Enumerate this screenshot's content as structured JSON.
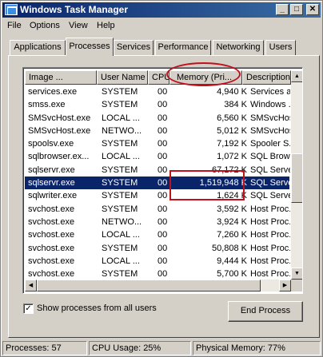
{
  "window": {
    "title": "Windows Task Manager",
    "minimize": "_",
    "maximize": "□",
    "close": "✕"
  },
  "menu": [
    "File",
    "Options",
    "View",
    "Help"
  ],
  "tabs": [
    "Applications",
    "Processes",
    "Services",
    "Performance",
    "Networking",
    "Users"
  ],
  "active_tab": "Processes",
  "columns": [
    "Image ...",
    "User Name",
    "CPU",
    "Memory (Pri...",
    "Description"
  ],
  "sorted_column": "Memory (Pri...",
  "processes": [
    {
      "image": "services.exe",
      "user": "SYSTEM",
      "cpu": "00",
      "memory": "4,940 K",
      "desc": "Services a..."
    },
    {
      "image": "smss.exe",
      "user": "SYSTEM",
      "cpu": "00",
      "memory": "384 K",
      "desc": "Windows ..."
    },
    {
      "image": "SMSvcHost.exe",
      "user": "LOCAL ...",
      "cpu": "00",
      "memory": "6,560 K",
      "desc": "SMSvcHos..."
    },
    {
      "image": "SMSvcHost.exe",
      "user": "NETWO...",
      "cpu": "00",
      "memory": "5,012 K",
      "desc": "SMSvcHos..."
    },
    {
      "image": "spoolsv.exe",
      "user": "SYSTEM",
      "cpu": "00",
      "memory": "7,192 K",
      "desc": "Spooler S..."
    },
    {
      "image": "sqlbrowser.ex...",
      "user": "LOCAL ...",
      "cpu": "00",
      "memory": "1,072 K",
      "desc": "SQL Brow..."
    },
    {
      "image": "sqlservr.exe",
      "user": "SYSTEM",
      "cpu": "00",
      "memory": "67,172 K",
      "desc": "SQL Serve..."
    },
    {
      "image": "sqlservr.exe",
      "user": "SYSTEM",
      "cpu": "00",
      "memory": "1,519,948 K",
      "desc": "SQL Serve..."
    },
    {
      "image": "sqlwriter.exe",
      "user": "SYSTEM",
      "cpu": "00",
      "memory": "1,624 K",
      "desc": "SQL Serve..."
    },
    {
      "image": "svchost.exe",
      "user": "SYSTEM",
      "cpu": "00",
      "memory": "3,592 K",
      "desc": "Host Proc..."
    },
    {
      "image": "svchost.exe",
      "user": "NETWO...",
      "cpu": "00",
      "memory": "3,924 K",
      "desc": "Host Proc..."
    },
    {
      "image": "svchost.exe",
      "user": "LOCAL ...",
      "cpu": "00",
      "memory": "7,260 K",
      "desc": "Host Proc..."
    },
    {
      "image": "svchost.exe",
      "user": "SYSTEM",
      "cpu": "00",
      "memory": "50,808 K",
      "desc": "Host Proc..."
    },
    {
      "image": "svchost.exe",
      "user": "LOCAL ...",
      "cpu": "00",
      "memory": "9,444 K",
      "desc": "Host Proc..."
    },
    {
      "image": "svchost.exe",
      "user": "SYSTEM",
      "cpu": "00",
      "memory": "5,700 K",
      "desc": "Host Proc..."
    }
  ],
  "selected_row_index": 7,
  "show_all_users": {
    "label": "Show processes from all users",
    "checked": true,
    "mark": "✓"
  },
  "end_process_label": "End Process",
  "status": {
    "processes": "Processes: 57",
    "cpu": "CPU Usage: 25%",
    "memory": "Physical Memory: 77%"
  },
  "colors": {
    "selection": "#0a246a",
    "annotation": "#c0101c",
    "title_start": "#0a246a",
    "title_end": "#3a6ea5"
  }
}
